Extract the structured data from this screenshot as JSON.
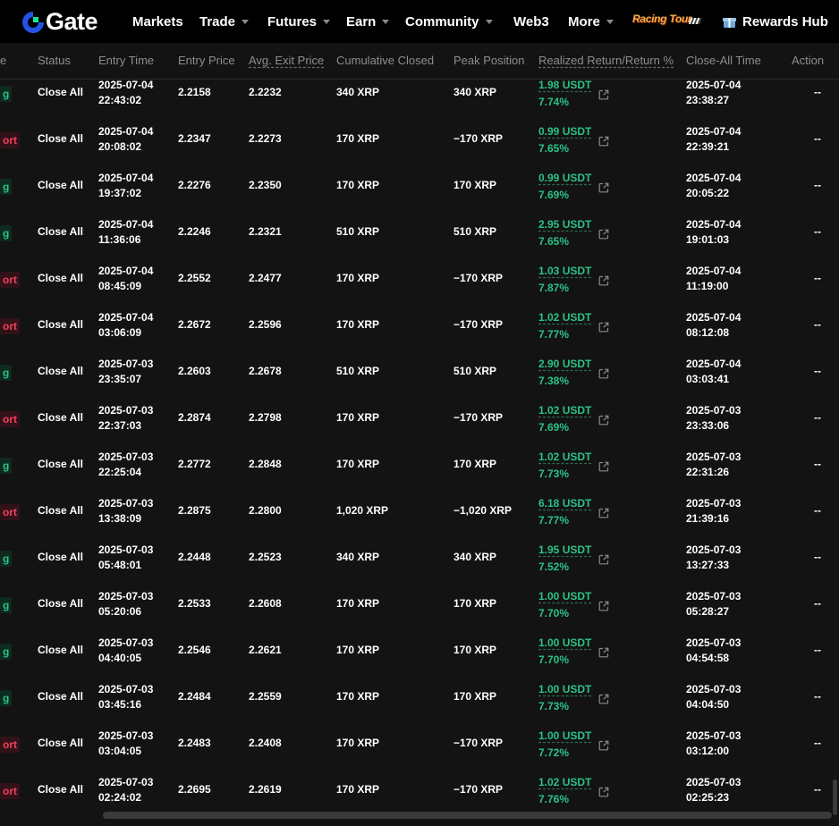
{
  "nav": {
    "logo_text": "Gate",
    "items": [
      {
        "label": "Markets",
        "caret": false
      },
      {
        "label": "Trade",
        "caret": true
      },
      {
        "label": "Futures",
        "caret": true
      },
      {
        "label": "Earn",
        "caret": true
      },
      {
        "label": "Community",
        "caret": true
      },
      {
        "label": "Web3",
        "caret": false
      },
      {
        "label": "More",
        "caret": true
      }
    ],
    "racing_label": "Racing Tour",
    "rewards_label": "Rewards Hub"
  },
  "table": {
    "headers": {
      "side": "e",
      "status": "Status",
      "entry_time": "Entry Time",
      "entry_price": "Entry Price",
      "avg_exit": "Avg. Exit Price",
      "cumulative": "Cumulative Closed",
      "peak": "Peak Position",
      "realized": "Realized Return/Return %",
      "close_time": "Close-All Time",
      "action": "Action"
    },
    "rows": [
      {
        "side": "g",
        "side_type": "long",
        "status": "Close All",
        "entry_date": "2025-07-04",
        "entry_clock": "22:43:02",
        "entry_price": "2.2158",
        "exit_price": "2.2232",
        "cumulative": "340 XRP",
        "peak": "340 XRP",
        "pnl": "1.98 USDT",
        "pct": "7.74%",
        "close_date": "2025-07-04",
        "close_clock": "23:38:27",
        "action": "--"
      },
      {
        "side": "ort",
        "side_type": "short",
        "status": "Close All",
        "entry_date": "2025-07-04",
        "entry_clock": "20:08:02",
        "entry_price": "2.2347",
        "exit_price": "2.2273",
        "cumulative": "170 XRP",
        "peak": "−170 XRP",
        "pnl": "0.99 USDT",
        "pct": "7.65%",
        "close_date": "2025-07-04",
        "close_clock": "22:39:21",
        "action": "--"
      },
      {
        "side": "g",
        "side_type": "long",
        "status": "Close All",
        "entry_date": "2025-07-04",
        "entry_clock": "19:37:02",
        "entry_price": "2.2276",
        "exit_price": "2.2350",
        "cumulative": "170 XRP",
        "peak": "170 XRP",
        "pnl": "0.99 USDT",
        "pct": "7.69%",
        "close_date": "2025-07-04",
        "close_clock": "20:05:22",
        "action": "--"
      },
      {
        "side": "g",
        "side_type": "long",
        "status": "Close All",
        "entry_date": "2025-07-04",
        "entry_clock": "11:36:06",
        "entry_price": "2.2246",
        "exit_price": "2.2321",
        "cumulative": "510 XRP",
        "peak": "510 XRP",
        "pnl": "2.95 USDT",
        "pct": "7.65%",
        "close_date": "2025-07-04",
        "close_clock": "19:01:03",
        "action": "--"
      },
      {
        "side": "ort",
        "side_type": "short",
        "status": "Close All",
        "entry_date": "2025-07-04",
        "entry_clock": "08:45:09",
        "entry_price": "2.2552",
        "exit_price": "2.2477",
        "cumulative": "170 XRP",
        "peak": "−170 XRP",
        "pnl": "1.03 USDT",
        "pct": "7.87%",
        "close_date": "2025-07-04",
        "close_clock": "11:19:00",
        "action": "--"
      },
      {
        "side": "ort",
        "side_type": "short",
        "status": "Close All",
        "entry_date": "2025-07-04",
        "entry_clock": "03:06:09",
        "entry_price": "2.2672",
        "exit_price": "2.2596",
        "cumulative": "170 XRP",
        "peak": "−170 XRP",
        "pnl": "1.02 USDT",
        "pct": "7.77%",
        "close_date": "2025-07-04",
        "close_clock": "08:12:08",
        "action": "--"
      },
      {
        "side": "g",
        "side_type": "long",
        "status": "Close All",
        "entry_date": "2025-07-03",
        "entry_clock": "23:35:07",
        "entry_price": "2.2603",
        "exit_price": "2.2678",
        "cumulative": "510 XRP",
        "peak": "510 XRP",
        "pnl": "2.90 USDT",
        "pct": "7.38%",
        "close_date": "2025-07-04",
        "close_clock": "03:03:41",
        "action": "--"
      },
      {
        "side": "ort",
        "side_type": "short",
        "status": "Close All",
        "entry_date": "2025-07-03",
        "entry_clock": "22:37:03",
        "entry_price": "2.2874",
        "exit_price": "2.2798",
        "cumulative": "170 XRP",
        "peak": "−170 XRP",
        "pnl": "1.02 USDT",
        "pct": "7.69%",
        "close_date": "2025-07-03",
        "close_clock": "23:33:06",
        "action": "--"
      },
      {
        "side": "g",
        "side_type": "long",
        "status": "Close All",
        "entry_date": "2025-07-03",
        "entry_clock": "22:25:04",
        "entry_price": "2.2772",
        "exit_price": "2.2848",
        "cumulative": "170 XRP",
        "peak": "170 XRP",
        "pnl": "1.02 USDT",
        "pct": "7.73%",
        "close_date": "2025-07-03",
        "close_clock": "22:31:26",
        "action": "--"
      },
      {
        "side": "ort",
        "side_type": "short",
        "status": "Close All",
        "entry_date": "2025-07-03",
        "entry_clock": "13:38:09",
        "entry_price": "2.2875",
        "exit_price": "2.2800",
        "cumulative": "1,020 XRP",
        "peak": "−1,020 XRP",
        "pnl": "6.18 USDT",
        "pct": "7.77%",
        "close_date": "2025-07-03",
        "close_clock": "21:39:16",
        "action": "--"
      },
      {
        "side": "g",
        "side_type": "long",
        "status": "Close All",
        "entry_date": "2025-07-03",
        "entry_clock": "05:48:01",
        "entry_price": "2.2448",
        "exit_price": "2.2523",
        "cumulative": "340 XRP",
        "peak": "340 XRP",
        "pnl": "1.95 USDT",
        "pct": "7.52%",
        "close_date": "2025-07-03",
        "close_clock": "13:27:33",
        "action": "--"
      },
      {
        "side": "g",
        "side_type": "long",
        "status": "Close All",
        "entry_date": "2025-07-03",
        "entry_clock": "05:20:06",
        "entry_price": "2.2533",
        "exit_price": "2.2608",
        "cumulative": "170 XRP",
        "peak": "170 XRP",
        "pnl": "1.00 USDT",
        "pct": "7.70%",
        "close_date": "2025-07-03",
        "close_clock": "05:28:27",
        "action": "--"
      },
      {
        "side": "g",
        "side_type": "long",
        "status": "Close All",
        "entry_date": "2025-07-03",
        "entry_clock": "04:40:05",
        "entry_price": "2.2546",
        "exit_price": "2.2621",
        "cumulative": "170 XRP",
        "peak": "170 XRP",
        "pnl": "1.00 USDT",
        "pct": "7.70%",
        "close_date": "2025-07-03",
        "close_clock": "04:54:58",
        "action": "--"
      },
      {
        "side": "g",
        "side_type": "long",
        "status": "Close All",
        "entry_date": "2025-07-03",
        "entry_clock": "03:45:16",
        "entry_price": "2.2484",
        "exit_price": "2.2559",
        "cumulative": "170 XRP",
        "peak": "170 XRP",
        "pnl": "1.00 USDT",
        "pct": "7.73%",
        "close_date": "2025-07-03",
        "close_clock": "04:04:50",
        "action": "--"
      },
      {
        "side": "ort",
        "side_type": "short",
        "status": "Close All",
        "entry_date": "2025-07-03",
        "entry_clock": "03:04:05",
        "entry_price": "2.2483",
        "exit_price": "2.2408",
        "cumulative": "170 XRP",
        "peak": "−170 XRP",
        "pnl": "1.00 USDT",
        "pct": "7.72%",
        "close_date": "2025-07-03",
        "close_clock": "03:12:00",
        "action": "--"
      },
      {
        "side": "ort",
        "side_type": "short",
        "status": "Close All",
        "entry_date": "2025-07-03",
        "entry_clock": "02:24:02",
        "entry_price": "2.2695",
        "exit_price": "2.2619",
        "cumulative": "170 XRP",
        "peak": "−170 XRP",
        "pnl": "1.02 USDT",
        "pct": "7.76%",
        "close_date": "2025-07-03",
        "close_clock": "02:25:23",
        "action": "--"
      }
    ]
  }
}
